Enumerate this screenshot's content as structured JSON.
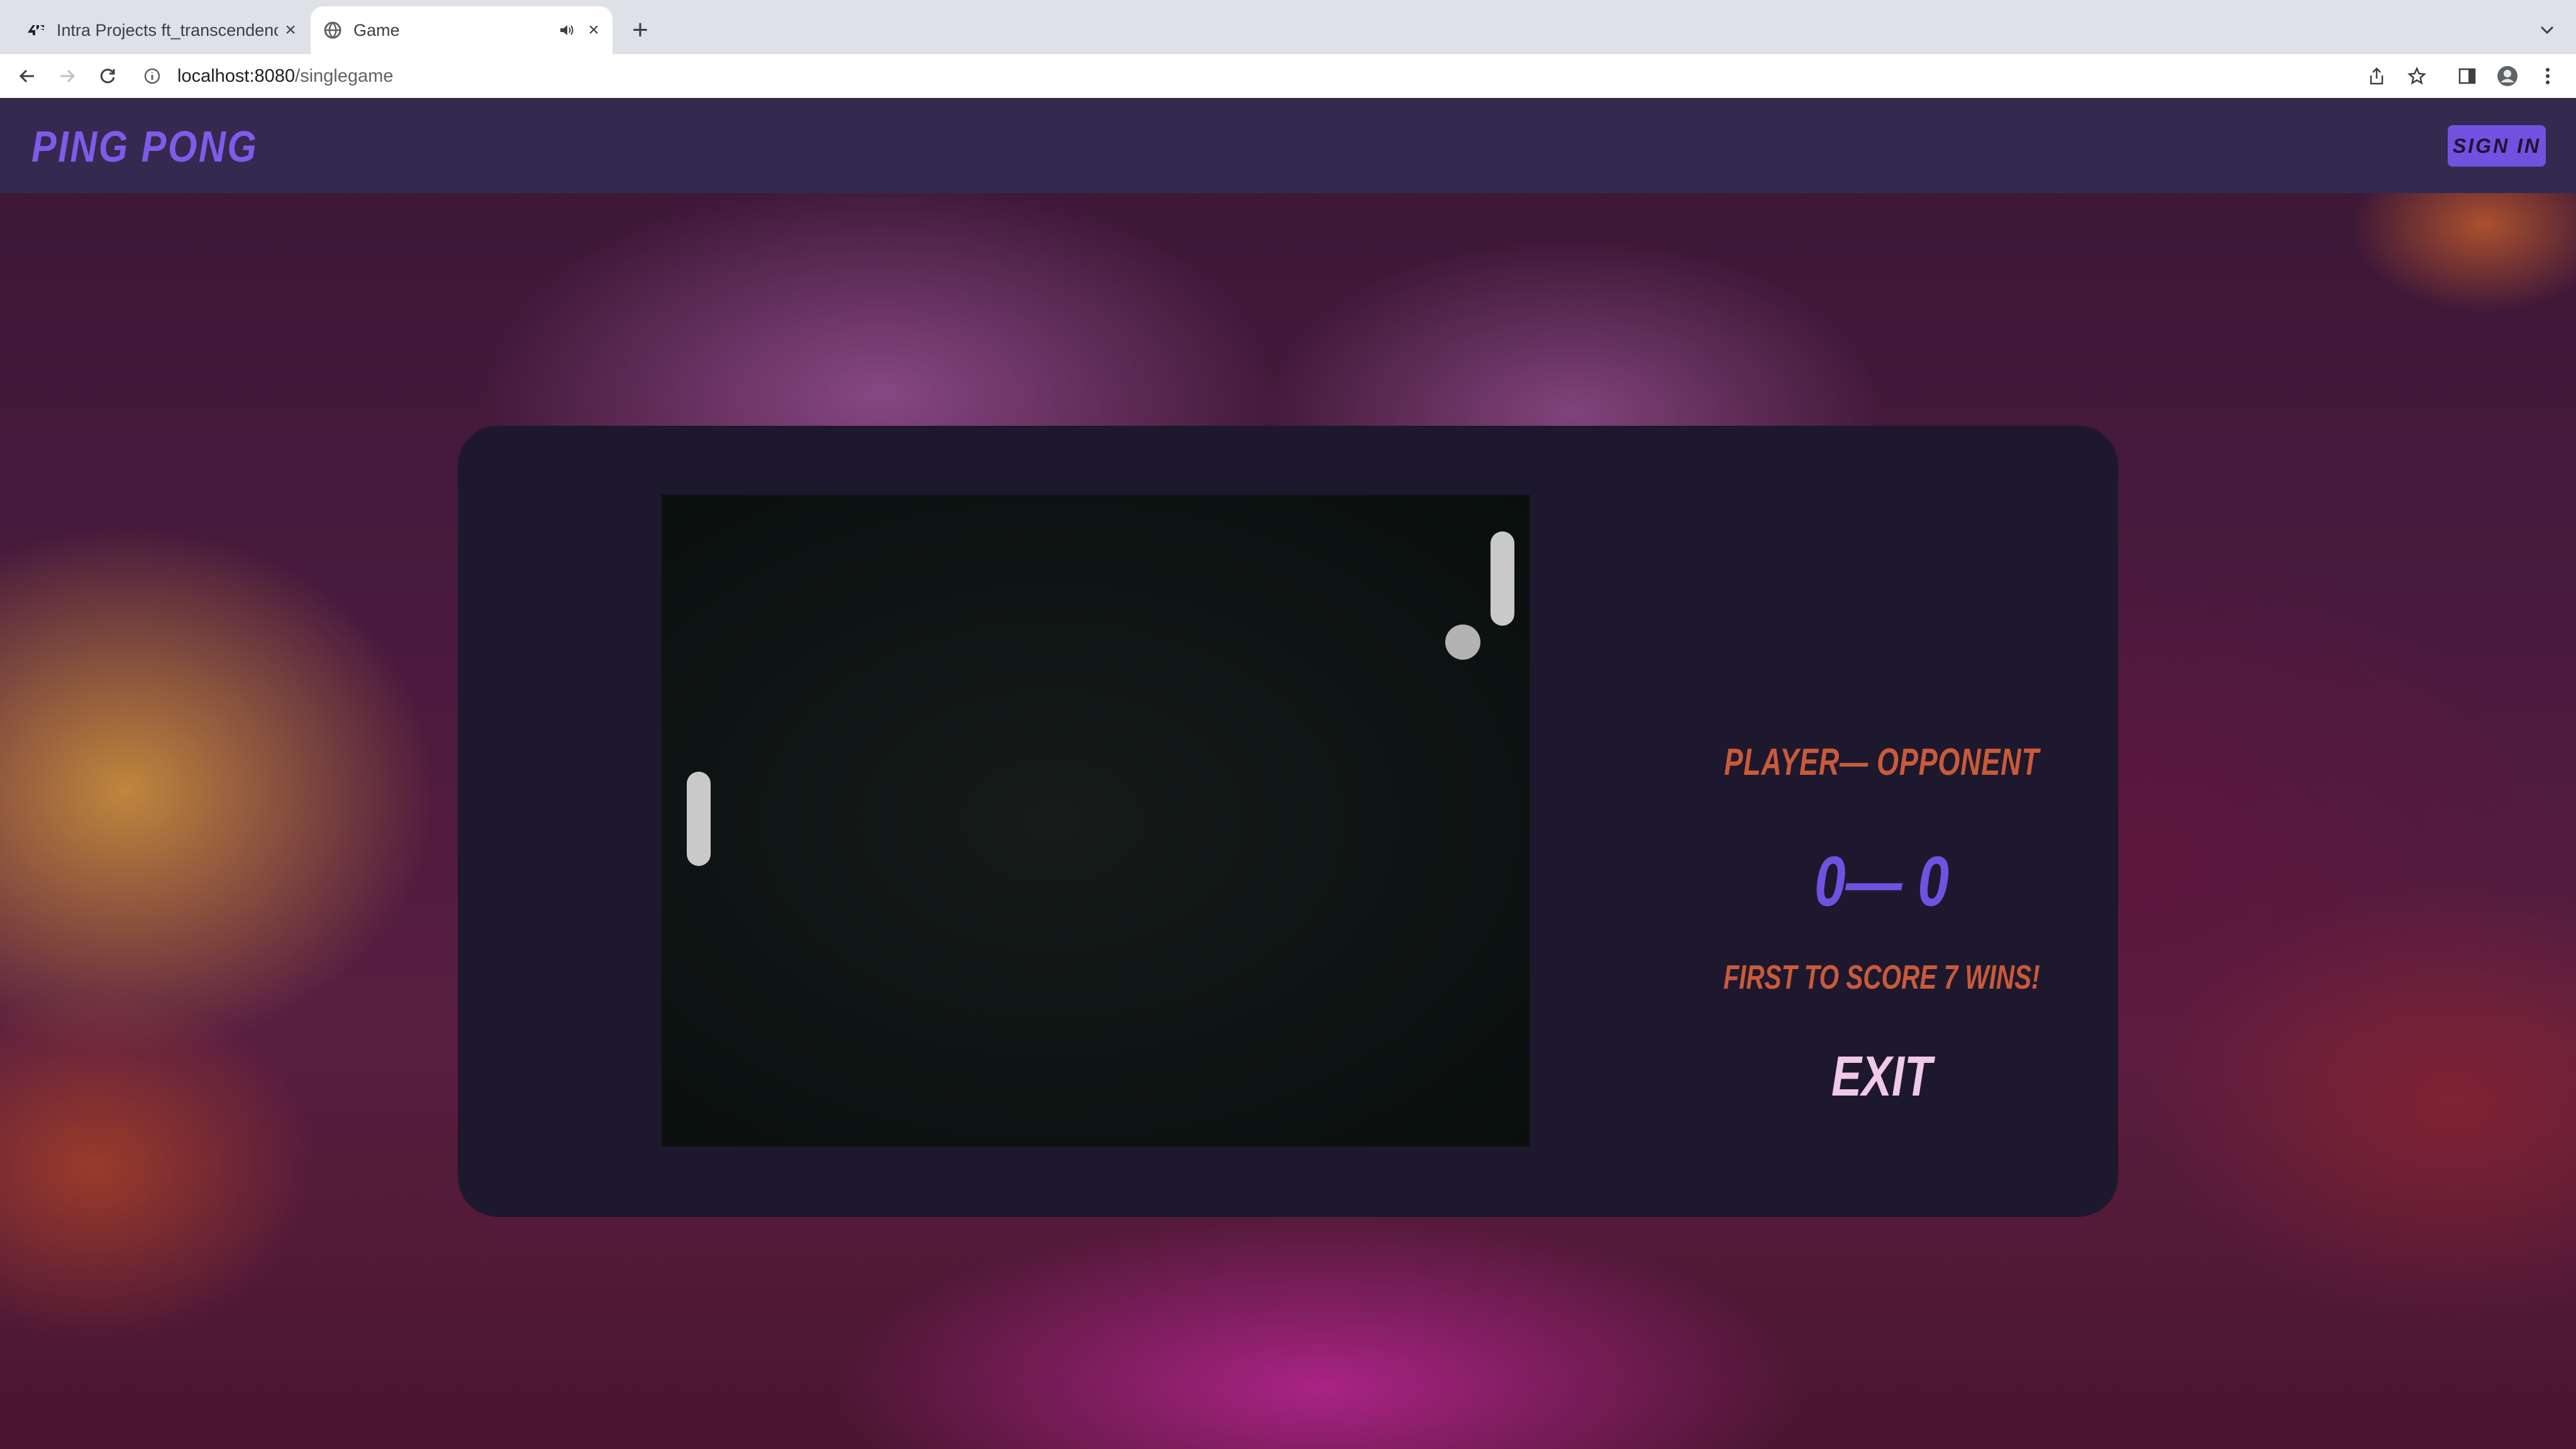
{
  "browser": {
    "tabs": [
      {
        "title": "Intra Projects ft_transcendence",
        "active": false
      },
      {
        "title": "Game",
        "active": true
      }
    ],
    "url_host": "localhost:8080",
    "url_path": "/singlegame"
  },
  "header": {
    "logo": "PING PONG",
    "sign_in_label": "SIGN IN"
  },
  "game": {
    "matchup_label": "PLAYER— OPPONENT",
    "score": "0— 0",
    "goal_text": "FIRST TO SCORE 7 WINS!",
    "exit_label": "EXIT"
  },
  "colors": {
    "header_bg": "#34294e",
    "accent_purple": "#6f52e0",
    "accent_orange": "#c95a3a",
    "exit_pink": "#f0c9e8",
    "card_bg": "#1d182d"
  }
}
